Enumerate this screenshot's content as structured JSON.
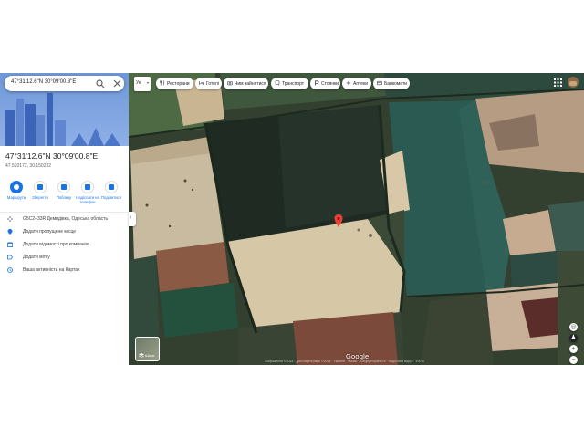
{
  "search": {
    "query": "47°31'12.6\"N 30°09'00.8\"E"
  },
  "place": {
    "title": "47°31'12.6\"N 30°09'00.8\"E",
    "subtitle": "47.520172, 30.150232"
  },
  "actions": [
    {
      "label": "Маршрути",
      "icon": "directions-icon"
    },
    {
      "label": "Зберегти",
      "icon": "bookmark-icon"
    },
    {
      "label": "Поблизу",
      "icon": "nearby-icon"
    },
    {
      "label": "Надіслати на телефон",
      "icon": "phone-icon"
    },
    {
      "label": "Поділитися",
      "icon": "share-icon"
    }
  ],
  "info_rows": [
    {
      "text": "G5C2+33R Демидівка, Одеська область",
      "icon": "plus-code-icon"
    },
    {
      "text": "Додати пропущене місце",
      "icon": "place-add-icon"
    },
    {
      "text": "Додати відомості про компанію",
      "icon": "business-icon"
    },
    {
      "text": "Додати мітку",
      "icon": "label-icon"
    },
    {
      "text": "Ваша активність на Картах",
      "icon": "history-icon"
    }
  ],
  "map": {
    "language_label": "Ук",
    "chips": [
      {
        "label": "Ресторани",
        "icon": "restaurant-icon"
      },
      {
        "label": "Готелі",
        "icon": "hotel-icon"
      },
      {
        "label": "Чим зайнятися",
        "icon": "camera-icon"
      },
      {
        "label": "Транспорт",
        "icon": "transit-icon"
      },
      {
        "label": "Стоянки",
        "icon": "parking-icon"
      },
      {
        "label": "Аптеки",
        "icon": "pharmacy-icon"
      },
      {
        "label": "Банкомати",
        "icon": "atm-icon"
      }
    ],
    "google_label": "Google",
    "layers_label": "Шари",
    "footer": "Зображення ©2024 · Дані картографії ©2024 · Україна · Умови · Конфіденційність · Надіслати відгук · 100 м"
  },
  "colors": {
    "accent": "#1a73e8",
    "pin": "#ea4335"
  }
}
